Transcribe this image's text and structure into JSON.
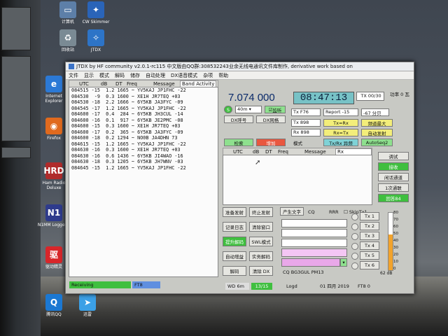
{
  "desktop": {
    "icons": [
      {
        "label": "计算机",
        "glyph": "▭",
        "color": "#5d7fa8"
      },
      {
        "label": "CW Skimmer",
        "glyph": "✦",
        "color": "#2a64b8"
      },
      {
        "label": "回收站",
        "glyph": "♻",
        "color": "#7a8a94"
      },
      {
        "label": "JTDX",
        "glyph": "✧",
        "color": "#2d74c7"
      },
      {
        "label": "Internet Explorer",
        "glyph": "e",
        "color": "#2b79d6"
      },
      {
        "label": "Firefox",
        "glyph": "◉",
        "color": "#e06a1e"
      },
      {
        "label": "Ham Radio Deluxe",
        "glyph": "HRD",
        "color": "#b02b2b"
      },
      {
        "label": "N1MM Logger+",
        "glyph": "N1",
        "color": "#2e3b8c"
      },
      {
        "label": "驱动精灵",
        "glyph": "驱",
        "color": "#d8262a"
      },
      {
        "label": "腾讯QQ",
        "glyph": "Q",
        "color": "#1b78d2"
      },
      {
        "label": "迅雷",
        "glyph": "➤",
        "color": "#3ba0e6"
      }
    ]
  },
  "window": {
    "title": "JTDX  by HF community       v2.0.1-rc115 中文版由QQ群:308532243业余无线电通讯文件库制作, derivative work based on",
    "menu": [
      "文件",
      "显示",
      "模式",
      "解码",
      "储存",
      "自动处理",
      "DX语音模式",
      "杂项",
      "帮助"
    ]
  },
  "band_activity": {
    "label": "Band Activity",
    "headers": [
      "UTC",
      "dB",
      "DT",
      "Freq",
      "Message"
    ],
    "rows": [
      "084515 -15  1.2 1665 ~ YV5KAJ JP1FHC -22",
      "084530  -9  0.3 1600 ~ XE1H JR7TEQ +03",
      "084530 -18  2.2 1666 ~ 6Y5KB JA3FYC -09",
      "084545 -17  1.2 1665 ~ YV5KAJ JP1FHC -22",
      "084600 -17  0.4  284 ~ 6Y5KB JH3CUL -14",
      "084600 -16  0.1  917 ~ 6Y5KB JE2PMC -08",
      "084600 -15  0.3 1600 ~ XE1H JR7TEQ +03",
      "084600 -17  0.2  365 ~ 6Y5KB JA3FYC -09",
      "084600 -18  0.2 1294 ~ NO0B JA4DHN 73",
      "084615 -15  1.2 1665 ~ YV5KAJ JP1FHC -22",
      "084630 -16  0.3 1600 ~ XE1H JR7TEQ +03",
      "084630 -16  0.6 1436 ~ 6Y5KB JI4WAO -16",
      "084630 -18  0.3 1205 ~ 6Y5KB JH7WNV -03",
      "084645 -15  1.2 1665 ~ YV5KAJ JP1FHC -22"
    ]
  },
  "rx_frequency": {
    "label": "Rx Frequency",
    "headers": [
      "UTC",
      "dB",
      "DT",
      "Freq",
      "Message"
    ]
  },
  "controls": {
    "frequency": "7.074  000",
    "clock": "08:47:13",
    "tx_box": "TX 00/30",
    "power_label": "功率 0 瓦",
    "band": "40m",
    "monitor": "监听",
    "s_badge": "S",
    "dx_call": "DX呼号",
    "dx_grid": "DX网格",
    "lookup": "检索",
    "add": "增加",
    "tx_freq": "Tx F76",
    "report": "Report -15",
    "db": "-67 分贝",
    "tx_hz": "Tx 898",
    "rx_hz": "Rx 898",
    "tx_eq_rx": "Tx=Rx",
    "rx_eq_tx": "Rx=Tx",
    "vfo_max": "频道最大",
    "auto_tx": "自动发射",
    "txrx_swap": "Tx/Rx 异频",
    "autoseq": "AutoSeq2",
    "seq_label": "模式",
    "right_btns": [
      "调试",
      "接收",
      "闲话通道",
      "1次通联",
      "回答84"
    ],
    "ops": [
      "准备发射",
      "终止发射",
      "记录日志",
      "清除窗口",
      "提升解码",
      "SWL模式",
      "自动增益",
      "实务解码",
      "解码",
      "清除 DX"
    ],
    "gen_msgs": "产生文字",
    "cq_label": "CQ",
    "rrr": "RRR",
    "skiptx1": "SkipTx1",
    "tx_buttons": [
      "Tx 1",
      "Tx 2",
      "Tx 3",
      "Tx 4",
      "Tx 5",
      "Tx 6"
    ],
    "cq_msg": "CQ BG3GUL PM13",
    "meter_ticks": [
      "80",
      "70",
      "60",
      "50",
      "40",
      "30",
      "20",
      "10",
      "0"
    ],
    "meter_db": "62 dB",
    "meter_level": 0.62
  },
  "statusbar": {
    "receiving": "Receiving",
    "mode": "FT8",
    "wd": "WD 6m",
    "count": "13/15",
    "logd": "Logd",
    "date": "01 四月 2019",
    "ft": "FT8  0"
  }
}
